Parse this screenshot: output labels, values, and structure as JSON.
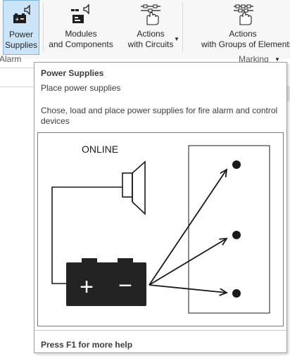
{
  "ribbon": {
    "buttons": [
      {
        "label_line1": "Power",
        "label_line2": "Supplies",
        "icon": "power-supply-icon",
        "active": true
      },
      {
        "label_line1": "Modules",
        "label_line2": "and Components",
        "icon": "modules-icon",
        "active": false
      },
      {
        "label_line1": "Actions",
        "label_line2": "with Circuits",
        "icon": "circuit-hand-icon",
        "active": false,
        "has_dropdown": true
      },
      {
        "label_line1": "Actions",
        "label_line2": "with Groups of Elements",
        "icon": "group-hand-icon",
        "active": false
      }
    ],
    "group_left": "Alarm",
    "group_right": "Marking"
  },
  "tooltip": {
    "title": "Power Supplies",
    "subtitle": "Place power supplies",
    "description": "Chose, load and place power supplies for fire alarm and control devices",
    "diagram_label": "ONLINE",
    "diagram_terminals": [
      "+",
      "−"
    ],
    "help": "Press F1 for more help"
  },
  "colors": {
    "active_bg": "#cce4f7",
    "active_border": "#7fb4e0",
    "battery": "#232323"
  }
}
